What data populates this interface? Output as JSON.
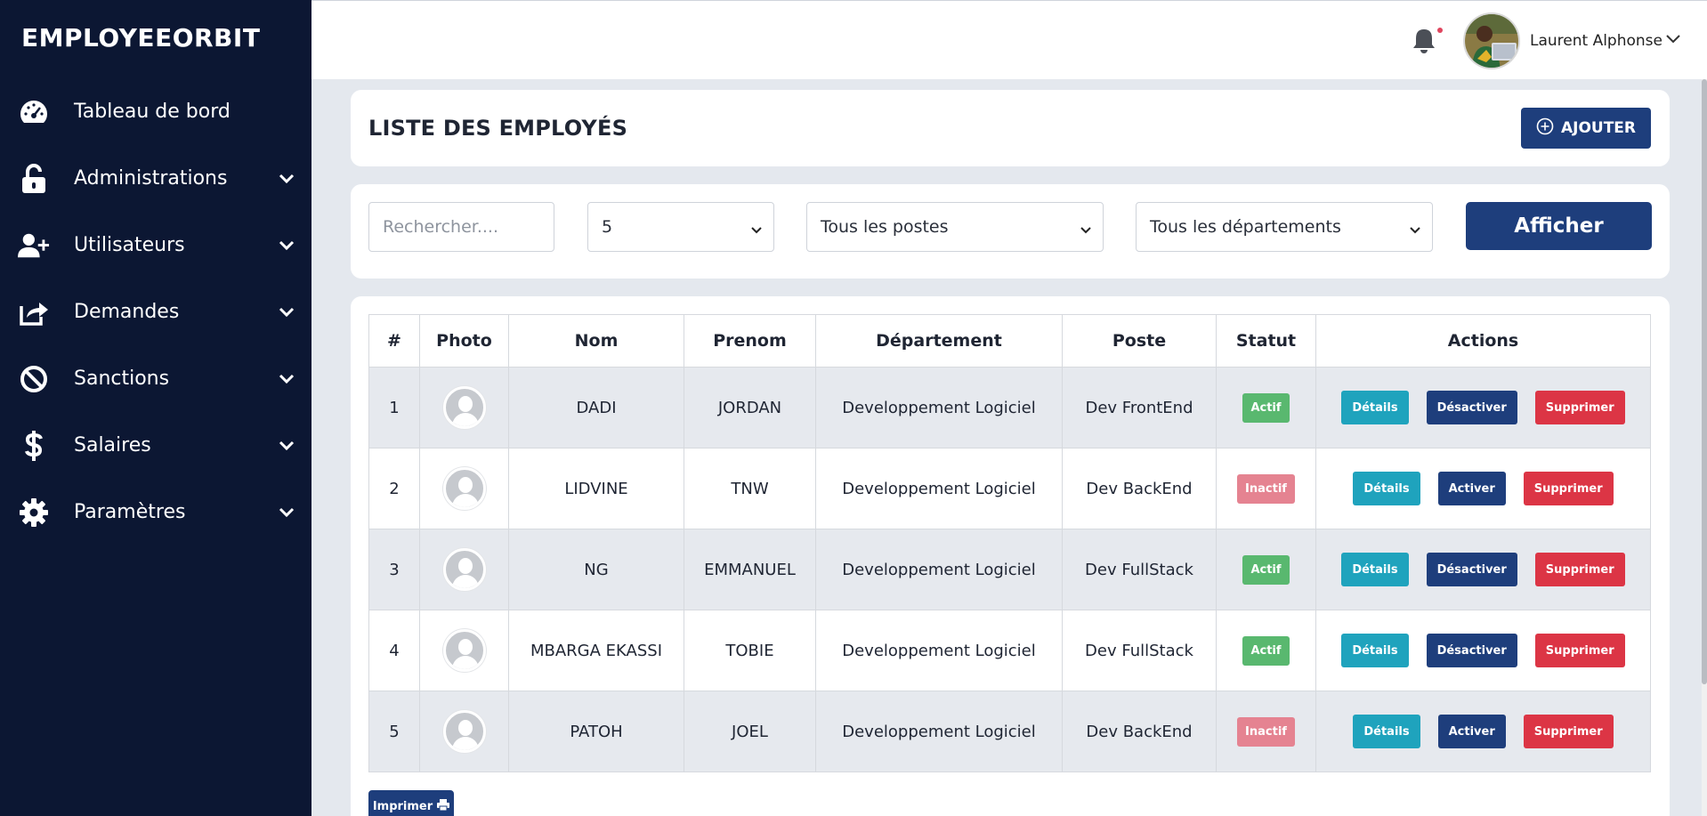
{
  "brand": {
    "logo_text": "EMPLOYEEORBIT"
  },
  "sidebar": {
    "items": [
      {
        "label": "Tableau de bord",
        "icon": "tachometer-icon"
      },
      {
        "label": "Administrations",
        "icon": "unlock-icon"
      },
      {
        "label": "Utilisateurs",
        "icon": "user-plus-icon"
      },
      {
        "label": "Demandes",
        "icon": "share-icon"
      },
      {
        "label": "Sanctions",
        "icon": "ban-icon"
      },
      {
        "label": "Salaires",
        "icon": "dollar-icon"
      },
      {
        "label": "Paramètres",
        "icon": "gear-icon"
      }
    ]
  },
  "header": {
    "user_name": "Laurent Alphonse"
  },
  "page": {
    "title": "LISTE DES EMPLOYÉS",
    "add_label": "AJOUTER"
  },
  "filters": {
    "search_placeholder": "Rechercher....",
    "count_value": "5",
    "poste_value": "Tous les postes",
    "dept_value": "Tous les départements",
    "show_label": "Afficher"
  },
  "table": {
    "headers": [
      "#",
      "Photo",
      "Nom",
      "Prenom",
      "Département",
      "Poste",
      "Statut",
      "Actions"
    ],
    "rows": [
      {
        "num": "1",
        "nom": "DADI",
        "prenom": "JORDAN",
        "dept": "Developpement Logiciel",
        "poste": "Dev FrontEnd",
        "statut": "Actif",
        "toggle": "Désactiver"
      },
      {
        "num": "2",
        "nom": "LIDVINE",
        "prenom": "TNW",
        "dept": "Developpement Logiciel",
        "poste": "Dev BackEnd",
        "statut": "Inactif",
        "toggle": "Activer"
      },
      {
        "num": "3",
        "nom": "NG",
        "prenom": "EMMANUEL",
        "dept": "Developpement Logiciel",
        "poste": "Dev FullStack",
        "statut": "Actif",
        "toggle": "Désactiver"
      },
      {
        "num": "4",
        "nom": "MBARGA EKASSI",
        "prenom": "TOBIE",
        "dept": "Developpement Logiciel",
        "poste": "Dev FullStack",
        "statut": "Actif",
        "toggle": "Désactiver"
      },
      {
        "num": "5",
        "nom": "PATOH",
        "prenom": "JOEL",
        "dept": "Developpement Logiciel",
        "poste": "Dev BackEnd",
        "statut": "Inactif",
        "toggle": "Activer"
      }
    ],
    "details_label": "Détails",
    "delete_label": "Supprimer"
  },
  "print_label": "Imprimer",
  "colors": {
    "sidebar_bg": "#0c1733",
    "primary": "#1e3e7c",
    "info": "#1fa3bd",
    "danger": "#dc3545",
    "success": "#59b86f",
    "inactive": "#e58391"
  }
}
